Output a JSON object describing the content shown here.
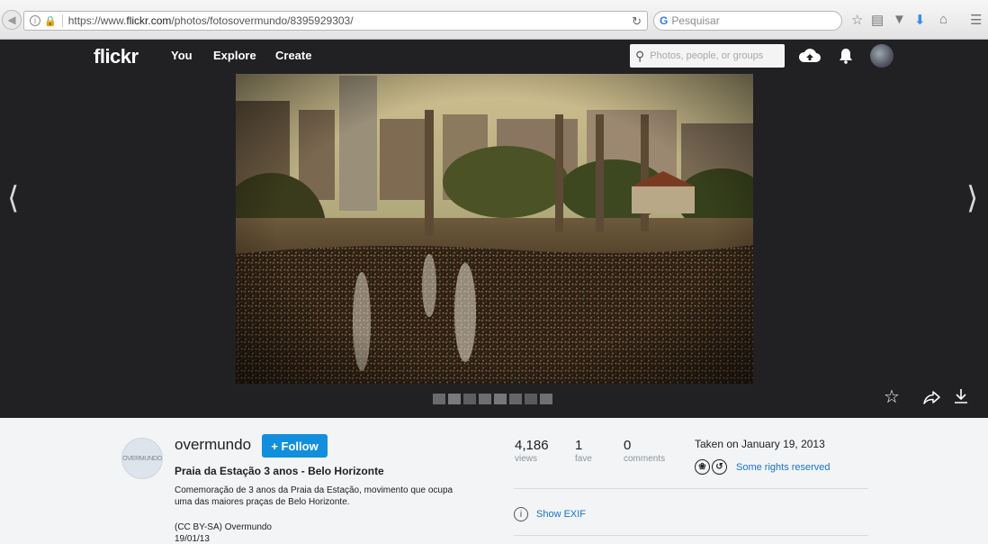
{
  "browser": {
    "url_prefix": "https://www.",
    "url_domain": "flickr.com",
    "url_path": "/photos/fotosovermundo/8395929303/",
    "search_placeholder": "Pesquisar"
  },
  "nav": {
    "logo": "flickr",
    "links": [
      "You",
      "Explore",
      "Create"
    ],
    "search_placeholder": "Photos, people, or groups"
  },
  "photo": {
    "title": "Praia da Estação 3 anos - Belo Horizonte",
    "description": "Comemoração de 3 anos da Praia da Estação, movimento que ocupa uma das maiores praças de Belo Horizonte.",
    "license_line": "(CC BY-SA) Overmundo",
    "date_line": "19/01/13"
  },
  "owner": {
    "name": "overmundo",
    "avatar_text": "OVERMUNDO",
    "follow_label": "+ Follow"
  },
  "stats": [
    {
      "value": "4,186",
      "label": "views"
    },
    {
      "value": "1",
      "label": "fave"
    },
    {
      "value": "0",
      "label": "comments"
    }
  ],
  "taken": "Taken on January 19, 2013",
  "rights_label": "Some rights reserved",
  "exif_label": "Show EXIF",
  "colors": {
    "nav_bg": "#212124",
    "follow_blue": "#128fdc",
    "link_blue": "#1a73c7",
    "panel_bg": "#f2f4f5"
  },
  "icons": [
    "back-arrow-icon",
    "info-icon",
    "lock-icon",
    "reload-icon",
    "search-engine-icon",
    "bookmark-star-icon",
    "reading-list-icon",
    "pocket-icon",
    "download-icon",
    "home-icon",
    "menu-icon",
    "search-icon",
    "upload-cloud-icon",
    "bell-icon",
    "fave-star-icon",
    "share-icon",
    "download-arrow-icon",
    "cc-attribution-icon",
    "cc-sharealike-icon"
  ]
}
